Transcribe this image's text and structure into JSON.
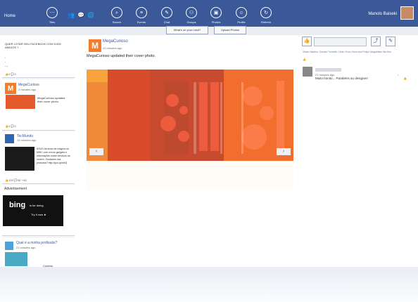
{
  "topbar": {
    "home": "Home",
    "nav": [
      {
        "label": "Tiles",
        "icon": "⋯"
      },
      {
        "label": "Search",
        "icon": "⌕"
      },
      {
        "label": "Events",
        "icon": "≡"
      },
      {
        "label": "Chat",
        "icon": "✎"
      },
      {
        "label": "Groups",
        "icon": "⚇"
      },
      {
        "label": "Photos",
        "icon": "▣"
      },
      {
        "label": "Profile",
        "icon": "☺"
      },
      {
        "label": "Refresh",
        "icon": "↻"
      }
    ],
    "user_name": "Manolo Baiseki"
  },
  "actions": {
    "mind": "What's on your mind?",
    "upload": "Upload Photos"
  },
  "left": {
    "post1": {
      "text": "QUER LOTAR SEU FACEBOOK COM 5.000 AMIGOS ?",
      "likes": "4",
      "comments": "3"
    },
    "post2": {
      "author": "MegaCurioso",
      "time": "2 minutes ago",
      "text": "MegaCurioso updated their cover photo.",
      "likes": "4",
      "comments": "3"
    },
    "post3": {
      "author": "TecMundo",
      "time": "12 minutes ago",
      "text": "ASUS dá show de mágica na MWC com novos gadgets e informações sobre serviços na nuvem. Gostaram dos produtos? http://goo.gl/xxf3j",
      "likes": "128",
      "comments": "58",
      "shares": "62"
    },
    "ad": {
      "title": "Advertisement",
      "brand": "bing",
      "slogan": "is for doing",
      "cta": "Try it now ►"
    },
    "post4": {
      "author": "Qual é a minha profissão?",
      "time": "21 minutes ago",
      "text": "Contest,"
    }
  },
  "main": {
    "author": "MegaCurioso",
    "time": "22 minutes ago",
    "text": "MegaCurioso updated their cover photo."
  },
  "right": {
    "likers": "Vitalio Martins, Donald Tunnelle, Deen Soon-Xiom and Felipe Magalhães like this.",
    "comment_time": "21 minutes ago",
    "comment": "Muito bonito... Parabéns ao designer!"
  }
}
